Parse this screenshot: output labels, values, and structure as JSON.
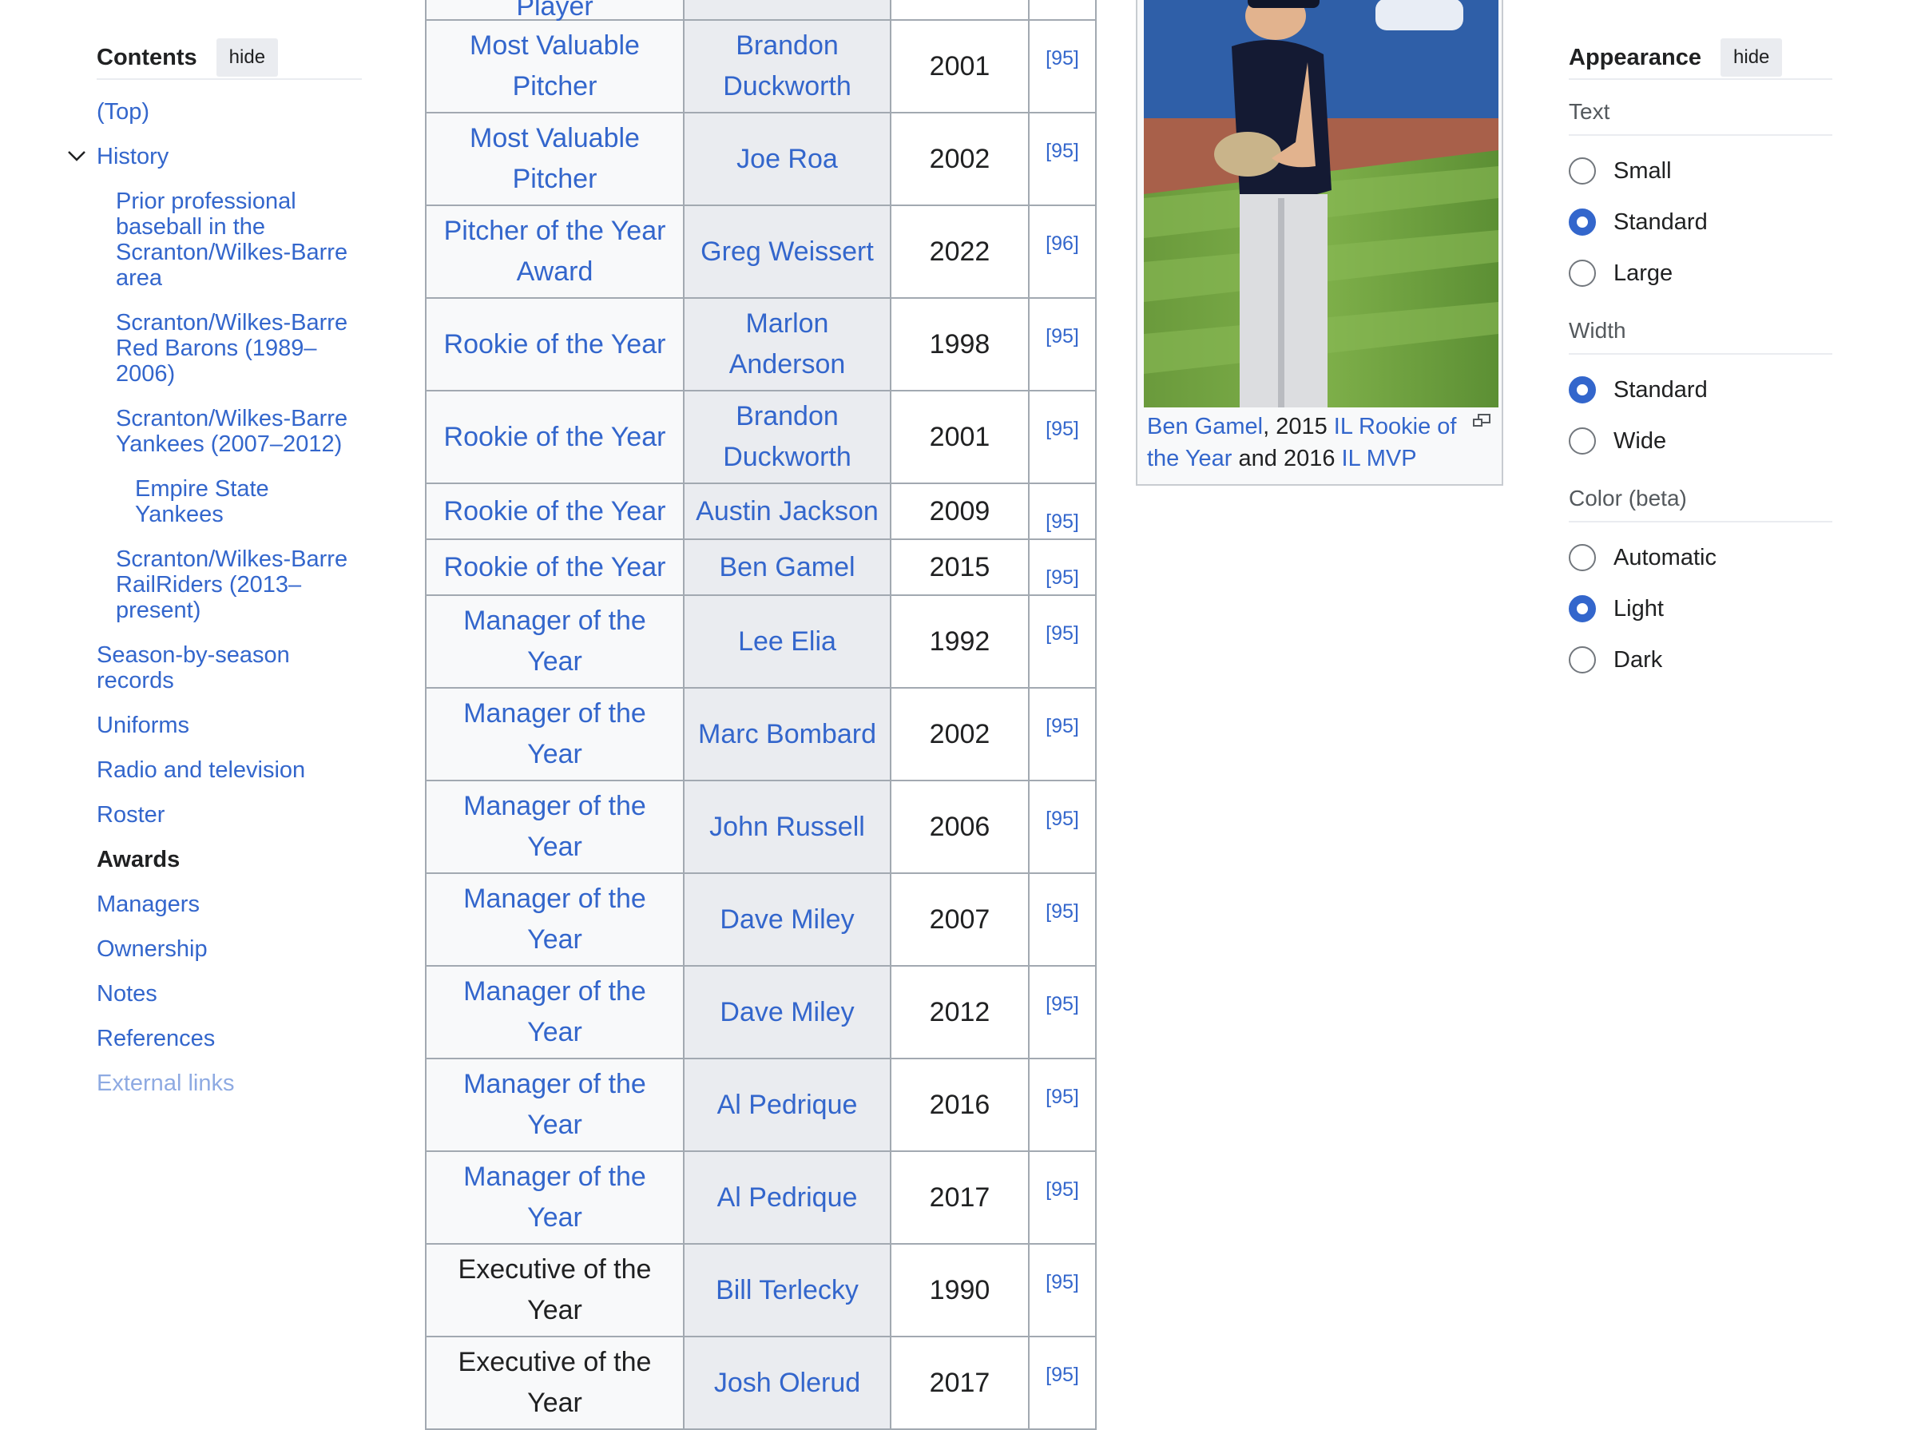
{
  "toc": {
    "title": "Contents",
    "hide_label": "hide",
    "items": [
      {
        "label": "(Top)",
        "level": 1
      },
      {
        "label": "History",
        "level": 1,
        "expanded": true
      },
      {
        "label": "Prior professional baseball in the Scranton/Wilkes-Barre area",
        "level": 2
      },
      {
        "label": "Scranton/Wilkes-Barre Red Barons (1989–2006)",
        "level": 2
      },
      {
        "label": "Scranton/Wilkes-Barre Yankees (2007–2012)",
        "level": 2
      },
      {
        "label": "Empire State Yankees",
        "level": 3
      },
      {
        "label": "Scranton/Wilkes-Barre RailRiders (2013–present)",
        "level": 2
      },
      {
        "label": "Season-by-season records",
        "level": 1
      },
      {
        "label": "Uniforms",
        "level": 1
      },
      {
        "label": "Radio and television",
        "level": 1
      },
      {
        "label": "Roster",
        "level": 1
      },
      {
        "label": "Awards",
        "level": 1,
        "active": true
      },
      {
        "label": "Managers",
        "level": 1
      },
      {
        "label": "Ownership",
        "level": 1
      },
      {
        "label": "Notes",
        "level": 1
      },
      {
        "label": "References",
        "level": 1
      },
      {
        "label": "External links",
        "level": 1
      }
    ]
  },
  "awards": {
    "rows": [
      {
        "award": "Player",
        "name": "",
        "year": "",
        "ref": "",
        "partial": true
      },
      {
        "award": "Most Valuable Pitcher",
        "name": "Brandon Duckworth",
        "year": "2001",
        "ref": "[95]"
      },
      {
        "award": "Most Valuable Pitcher",
        "name": "Joe Roa",
        "year": "2002",
        "ref": "[95]"
      },
      {
        "award": "Pitcher of the Year Award",
        "name": "Greg Weissert",
        "year": "2022",
        "ref": "[96]"
      },
      {
        "award": "Rookie of the Year",
        "name": "Marlon Anderson",
        "year": "1998",
        "ref": "[95]"
      },
      {
        "award": "Rookie of the Year",
        "name": "Brandon Duckworth",
        "year": "2001",
        "ref": "[95]"
      },
      {
        "award": "Rookie of the Year",
        "name": "Austin Jackson",
        "year": "2009",
        "ref": "[95]"
      },
      {
        "award": "Rookie of the Year",
        "name": "Ben Gamel",
        "year": "2015",
        "ref": "[95]"
      },
      {
        "award": "Manager of the Year",
        "name": "Lee Elia",
        "year": "1992",
        "ref": "[95]"
      },
      {
        "award": "Manager of the Year",
        "name": "Marc Bombard",
        "year": "2002",
        "ref": "[95]"
      },
      {
        "award": "Manager of the Year",
        "name": "John Russell",
        "year": "2006",
        "ref": "[95]"
      },
      {
        "award": "Manager of the Year",
        "name": "Dave Miley",
        "year": "2007",
        "ref": "[95]"
      },
      {
        "award": "Manager of the Year",
        "name": "Dave Miley",
        "year": "2012",
        "ref": "[95]"
      },
      {
        "award": "Manager of the Year",
        "name": "Al Pedrique",
        "year": "2016",
        "ref": "[95]"
      },
      {
        "award": "Manager of the Year",
        "name": "Al Pedrique",
        "year": "2017",
        "ref": "[95]"
      },
      {
        "award": "Executive of the Year",
        "name": "Bill Terlecky",
        "year": "1990",
        "ref": "[95]",
        "plain": true
      },
      {
        "award": "Executive of the Year",
        "name": "Josh Olerud",
        "year": "2017",
        "ref": "[95]",
        "plain": true
      }
    ]
  },
  "image": {
    "caption_parts": [
      {
        "text": "Ben Gamel",
        "link": true
      },
      {
        "text": ", 2015 ",
        "link": false
      },
      {
        "text": "IL",
        "link": true
      },
      {
        "text": " ",
        "link": false
      },
      {
        "text": "Rookie of the Year",
        "link": true
      },
      {
        "text": " and 2016 ",
        "link": false
      },
      {
        "text": "IL",
        "link": true
      },
      {
        "text": " ",
        "link": false
      },
      {
        "text": "MVP",
        "link": true
      }
    ]
  },
  "appearance": {
    "title": "Appearance",
    "hide_label": "hide",
    "groups": [
      {
        "label": "Text",
        "options": [
          {
            "label": "Small",
            "checked": false
          },
          {
            "label": "Standard",
            "checked": true
          },
          {
            "label": "Large",
            "checked": false
          }
        ]
      },
      {
        "label": "Width",
        "options": [
          {
            "label": "Standard",
            "checked": true
          },
          {
            "label": "Wide",
            "checked": false
          }
        ]
      },
      {
        "label": "Color (beta)",
        "options": [
          {
            "label": "Automatic",
            "checked": false
          },
          {
            "label": "Light",
            "checked": true
          },
          {
            "label": "Dark",
            "checked": false
          }
        ]
      }
    ]
  },
  "colors": {
    "link": "#3366cc",
    "accent": "#3366cc",
    "text": "#202122"
  }
}
